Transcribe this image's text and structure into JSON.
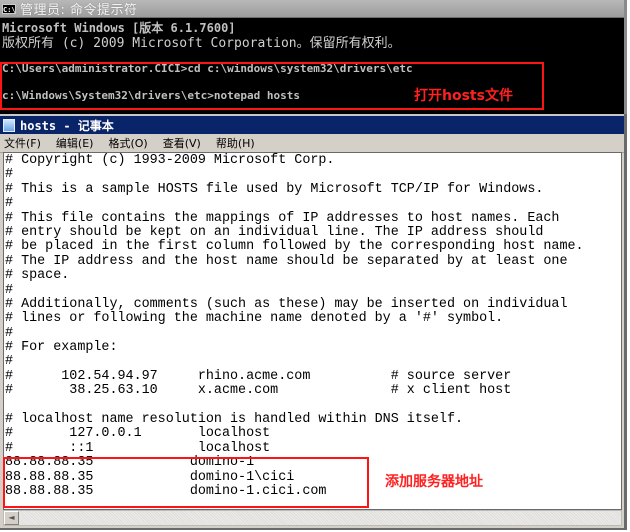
{
  "cmd": {
    "icon": "console-icon",
    "icon_text": "C:\\",
    "title": "管理员: 命令提示符",
    "lines": [
      "Microsoft Windows [版本 6.1.7600]",
      "版权所有 (c) 2009 Microsoft Corporation。保留所有权利。",
      "",
      "C:\\Users\\administrator.CICI>cd c:\\windows\\system32\\drivers\\etc",
      "",
      "c:\\Windows\\System32\\drivers\\etc>notepad hosts"
    ],
    "annotation": "打开hosts文件",
    "highlight_color": "#ff1414"
  },
  "notepad": {
    "icon": "notepad-icon",
    "title": "hosts - 记事本",
    "menu": [
      {
        "label": "文件(F)"
      },
      {
        "label": "编辑(E)"
      },
      {
        "label": "格式(O)"
      },
      {
        "label": "查看(V)"
      },
      {
        "label": "帮助(H)"
      }
    ],
    "content_lines": [
      "# Copyright (c) 1993-2009 Microsoft Corp.",
      "#",
      "# This is a sample HOSTS file used by Microsoft TCP/IP for Windows.",
      "#",
      "# This file contains the mappings of IP addresses to host names. Each",
      "# entry should be kept on an individual line. The IP address should",
      "# be placed in the first column followed by the corresponding host name.",
      "# The IP address and the host name should be separated by at least one",
      "# space.",
      "#",
      "# Additionally, comments (such as these) may be inserted on individual",
      "# lines or following the machine name denoted by a '#' symbol.",
      "#",
      "# For example:",
      "#",
      "#      102.54.94.97     rhino.acme.com          # source server",
      "#       38.25.63.10     x.acme.com              # x client host",
      "",
      "# localhost name resolution is handled within DNS itself.",
      "#       127.0.0.1       localhost",
      "#       ::1             localhost",
      "88.88.88.35            domino-1",
      "88.88.88.35            domino-1\\cici",
      "88.88.88.35            domino-1.cici.com"
    ],
    "annotation": "添加服务器地址",
    "highlight_color": "#ff1414",
    "scroll_left_icon": "◄"
  }
}
